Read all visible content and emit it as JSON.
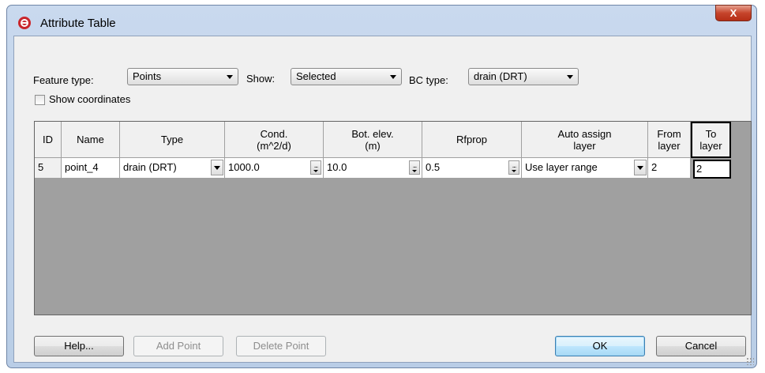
{
  "window": {
    "title": "Attribute Table",
    "close_label": "X"
  },
  "toolbar": {
    "feature_type_label": "Feature type:",
    "feature_type_value": "Points",
    "show_label": "Show:",
    "show_value": "Selected",
    "bc_type_label": "BC type:",
    "bc_type_value": "drain (DRT)",
    "show_coordinates_label": "Show coordinates",
    "show_coordinates_checked": false
  },
  "table": {
    "headers": {
      "id": "ID",
      "name": "Name",
      "type": "Type",
      "cond_1": "Cond.",
      "cond_2": "(m^2/d)",
      "bot_1": "Bot. elev.",
      "bot_2": "(m)",
      "rfprop": "Rfprop",
      "auto_1": "Auto assign",
      "auto_2": "layer",
      "from_1": "From",
      "from_2": "layer",
      "to_1": "To",
      "to_2": "layer"
    },
    "rows": [
      {
        "id": "5",
        "name": "point_4",
        "type": "drain (DRT)",
        "cond": "1000.0",
        "bot_elev": "10.0",
        "rfprop": "0.5",
        "auto_assign": "Use layer range",
        "from_layer": "2",
        "to_layer": "2"
      }
    ]
  },
  "buttons": {
    "help": "Help...",
    "add_point": "Add Point",
    "delete_point": "Delete Point",
    "ok": "OK",
    "cancel": "Cancel"
  },
  "colors": {
    "grid_background": "#a0a0a0",
    "dialog_background": "#f0f0f0",
    "close_button": "#c6442b"
  }
}
